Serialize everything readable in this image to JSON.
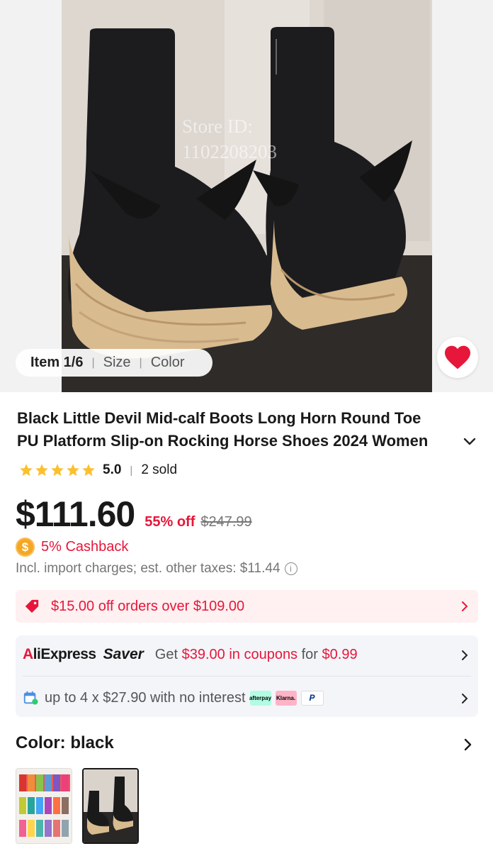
{
  "gallery": {
    "watermark_line1": "Store ID:",
    "watermark_line2": "1102208203",
    "item_label": "Item 1/6",
    "size_label": "Size",
    "color_label": "Color",
    "favorite_icon": "heart-icon",
    "favorite_color": "#e6173a"
  },
  "product": {
    "title_line1": "Black Little Devil Mid-calf Boots Long Horn Round Toe",
    "title_line2": "PU Platform Slip-on Rocking Horse Shoes 2024 Women",
    "rating_score": "5.0",
    "stars": 5,
    "sold": "2 sold",
    "price": "$111.60",
    "discount": "55% off",
    "original_price": "$247.99",
    "cashback_icon": "$",
    "cashback": "5% Cashback",
    "taxes": "Incl. import charges; est. other taxes: $11.44"
  },
  "coupon": {
    "text": "$15.00 off orders over $109.00",
    "icon": "tag-icon"
  },
  "saver": {
    "brand_a": "A",
    "brand_rest": "liExpress",
    "saver_label": "Saver",
    "get_prefix": "Get ",
    "get_coupons": "$39.00 in coupons",
    "get_for": " for ",
    "get_price": "$0.99"
  },
  "installments": {
    "text": "up to 4 x $27.90 with no interest",
    "afterpay": "afterpay",
    "klarna": "Klarna.",
    "paypal": "P"
  },
  "color": {
    "label": "Color: ",
    "value": "black"
  },
  "colors": {
    "accent": "#e6173a",
    "star": "#fbc02d"
  }
}
